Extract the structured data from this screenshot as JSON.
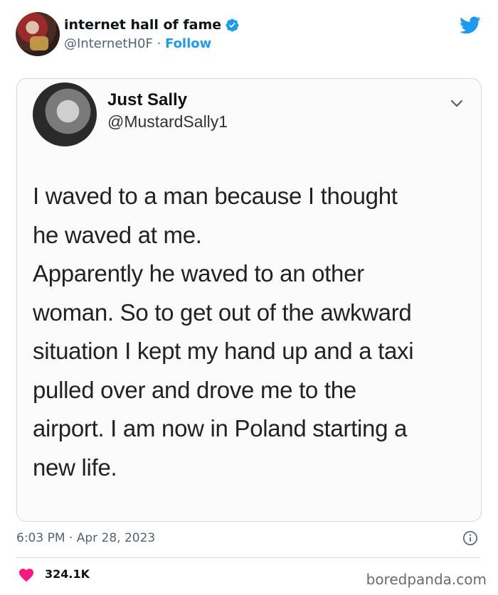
{
  "header": {
    "display_name": "internet hall of fame",
    "handle": "@InternetH0F",
    "separator": " · ",
    "follow_label": "Follow"
  },
  "embedded": {
    "name": "Just Sally",
    "handle": "@MustardSally1",
    "lines": [
      "I waved to a man because I thought",
      "he waved at me.",
      "Apparently he waved to an other",
      "woman. So to get out of the awkward",
      "situation I kept my hand up and a taxi",
      "pulled over and drove me to the",
      "airport. I am now in Poland starting a",
      "new life."
    ]
  },
  "footer": {
    "timestamp": "6:03 PM · Apr 28, 2023",
    "likes": "324.1K",
    "watermark": "boredpanda.com"
  },
  "colors": {
    "accent": "#1d9bf0",
    "heart": "#f91880",
    "muted": "#536471"
  },
  "icons": [
    "verified-badge-icon",
    "twitter-bird-icon",
    "chevron-down-icon",
    "info-icon",
    "heart-icon"
  ]
}
